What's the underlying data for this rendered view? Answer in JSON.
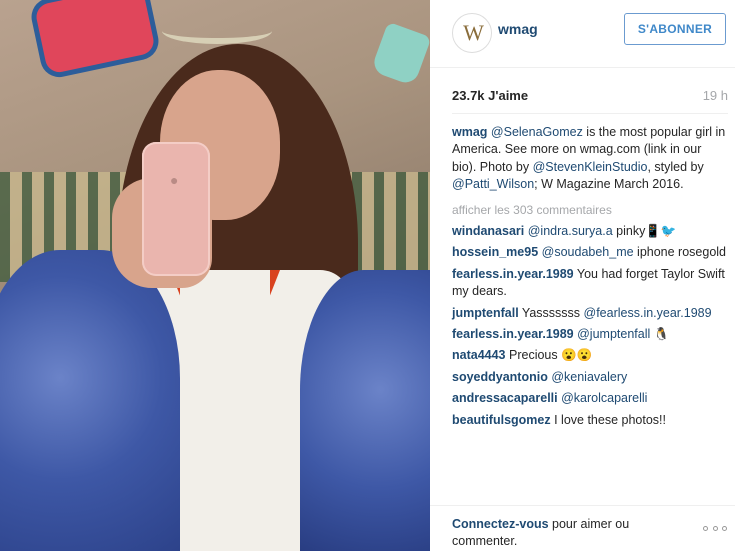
{
  "post": {
    "account": {
      "username": "wmag",
      "avatar_text": "W",
      "follow_label": "S'ABONNER"
    },
    "likes": "23.7k J'aime",
    "time_ago": "19 h",
    "caption": {
      "author": "wmag",
      "parts": [
        {
          "type": "mention",
          "text": "@SelenaGomez"
        },
        {
          "type": "text",
          "text": " is the most popular girl in America. See more on wmag.com (link in our bio). Photo by "
        },
        {
          "type": "mention",
          "text": "@StevenKleinStudio"
        },
        {
          "type": "text",
          "text": ", styled by "
        },
        {
          "type": "mention",
          "text": "@Patti_Wilson"
        },
        {
          "type": "text",
          "text": "; W Magazine March 2016."
        }
      ]
    },
    "view_all_comments": "afficher les 303 commentaires",
    "comments": [
      {
        "user": "windanasari",
        "parts": [
          {
            "type": "mention",
            "text": "@indra.surya.a"
          },
          {
            "type": "text",
            "text": " pinky📱🐦"
          }
        ]
      },
      {
        "user": "hossein_me95",
        "parts": [
          {
            "type": "mention",
            "text": "@soudabeh_me"
          },
          {
            "type": "text",
            "text": " iphone rosegold"
          }
        ]
      },
      {
        "user": "fearless.in.year.1989",
        "parts": [
          {
            "type": "text",
            "text": "You had forget Taylor Swift my dears."
          }
        ]
      },
      {
        "user": "jumptenfall",
        "parts": [
          {
            "type": "text",
            "text": "Yasssssss "
          },
          {
            "type": "mention",
            "text": "@fearless.in.year.1989"
          }
        ]
      },
      {
        "user": "fearless.in.year.1989",
        "parts": [
          {
            "type": "mention",
            "text": "@jumptenfall"
          },
          {
            "type": "text",
            "text": " 🐧"
          }
        ]
      },
      {
        "user": "nata4443",
        "parts": [
          {
            "type": "text",
            "text": "Precious 😮😮"
          }
        ]
      },
      {
        "user": "soyeddyantonio",
        "parts": [
          {
            "type": "mention",
            "text": "@keniavalery"
          }
        ]
      },
      {
        "user": "andressacaparelli",
        "parts": [
          {
            "type": "mention",
            "text": "@karolcaparelli"
          }
        ]
      },
      {
        "user": "beautifulsgomez",
        "parts": [
          {
            "type": "text",
            "text": "I love these photos!!"
          }
        ]
      }
    ],
    "footer": {
      "login_link": "Connectez-vous",
      "login_text": " pour aimer ou commenter."
    },
    "icons": {
      "avatar": "w-magazine-logo-icon",
      "more": "more-options-icon"
    }
  }
}
